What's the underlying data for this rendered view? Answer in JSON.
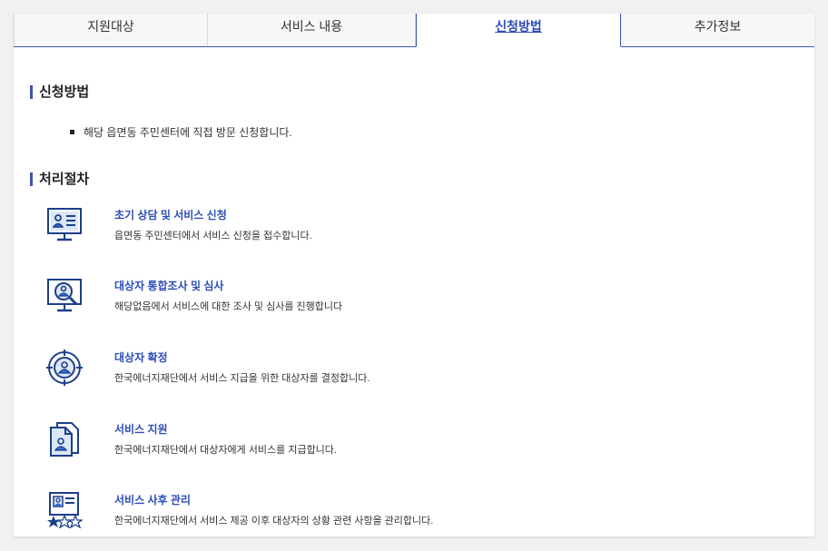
{
  "tabs": [
    {
      "label": "지원대상",
      "active": false
    },
    {
      "label": "서비스 내용",
      "active": false
    },
    {
      "label": "신청방법",
      "active": true
    },
    {
      "label": "추가정보",
      "active": false
    }
  ],
  "apply": {
    "title": "신청방법",
    "bullet": "해당 읍면동 주민센터에 직접 방문 신청합니다."
  },
  "process": {
    "title": "처리절차",
    "steps": [
      {
        "icon": "monitor-profile-icon",
        "title": "초기 상담 및 서비스 신청",
        "desc": "읍면동 주민센터에서 서비스 신청을 접수합니다."
      },
      {
        "icon": "monitor-magnifier-icon",
        "title": "대상자 통합조사 및 심사",
        "desc": "해당없음에서 서비스에 대한 조사 및 심사를 진행합니다"
      },
      {
        "icon": "target-person-icon",
        "title": "대상자 확정",
        "desc": "한국에너지재단에서 서비스 지급을 위한 대상자를 결정합니다."
      },
      {
        "icon": "document-person-icon",
        "title": "서비스 지원",
        "desc": "한국에너지재단에서 대상자에게 서비스를 지급합니다."
      },
      {
        "icon": "profile-card-stars-icon",
        "title": "서비스 사후 관리",
        "desc": "한국에너지재단에서 서비스 제공 이후 대상자의 상황 관련 사항을 관리합니다."
      }
    ]
  },
  "colors": {
    "accent": "#3b56b4",
    "link": "#2b4db8",
    "icon": "#1d3f8a"
  }
}
